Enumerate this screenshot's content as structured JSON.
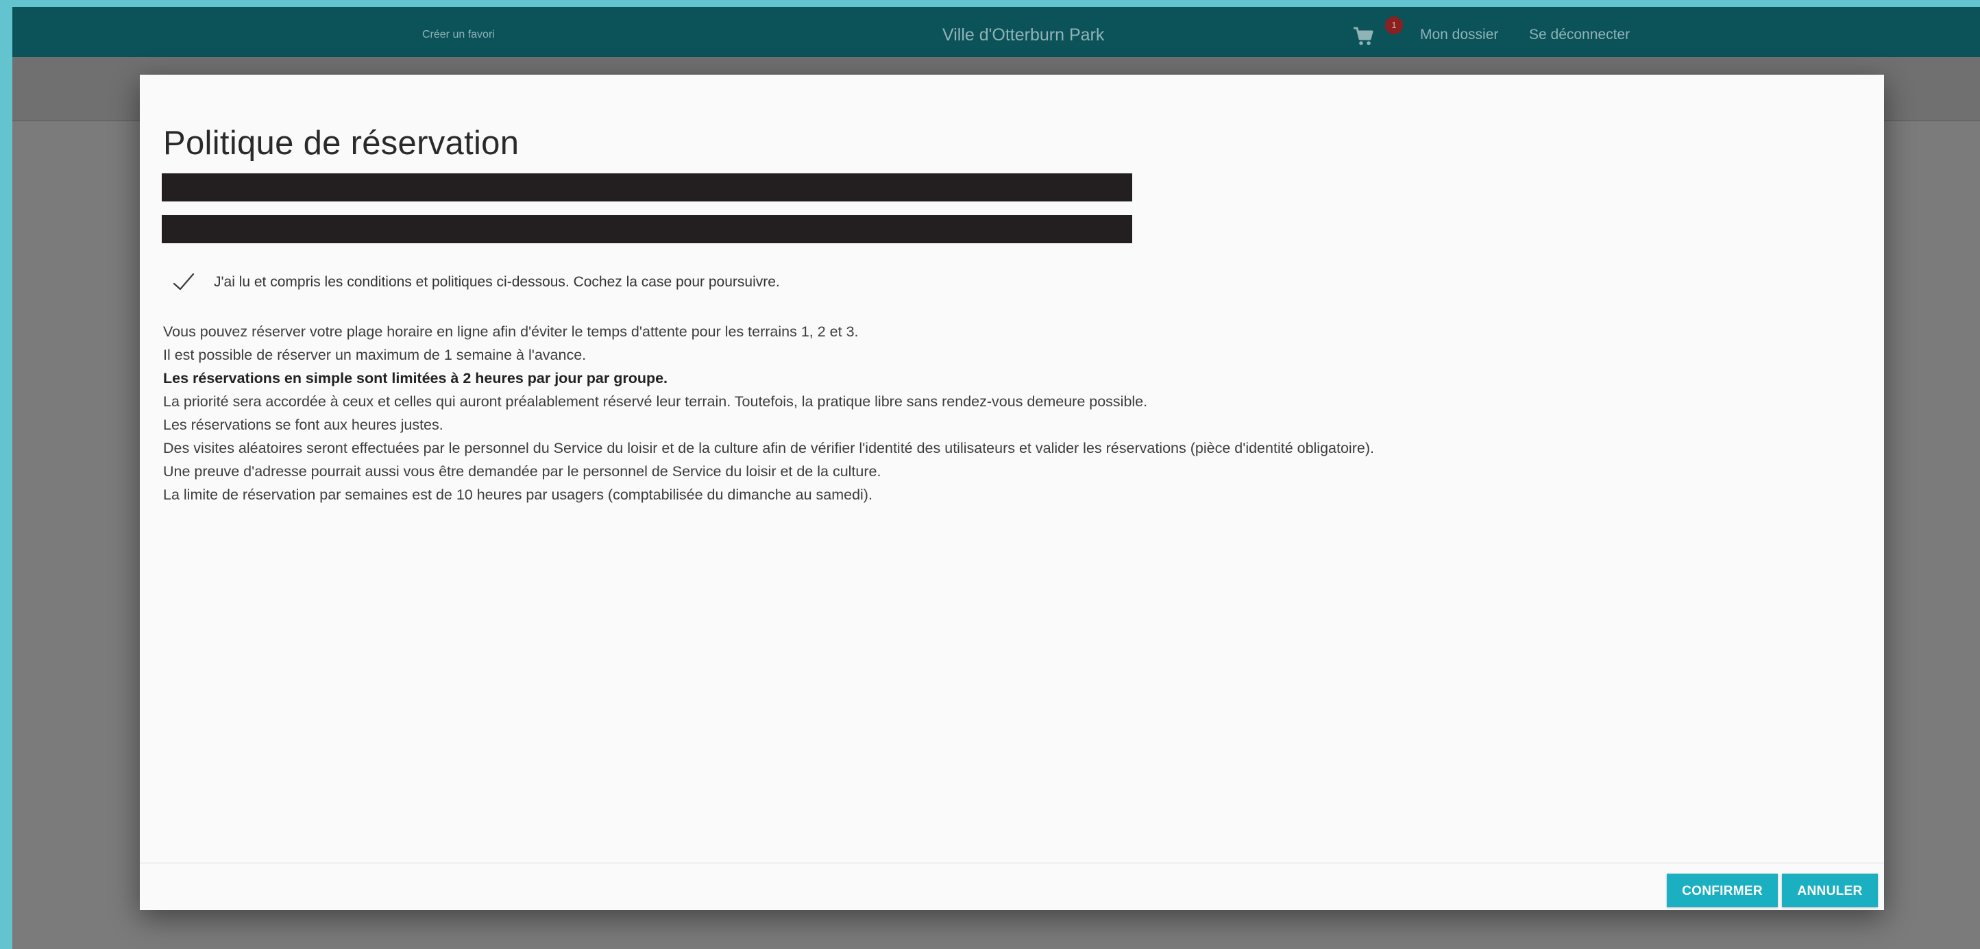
{
  "header": {
    "favorite_link": "Créer un favori",
    "site_title": "Ville d'Otterburn Park",
    "cart_icon": "cart-icon",
    "cart_count": "1",
    "my_account": "Mon dossier",
    "logout": "Se déconnecter"
  },
  "modal": {
    "title": "Politique de réservation",
    "acknowledge_text": "J'ai lu et compris les conditions et politiques ci-dessous. Cochez la case pour poursuivre.",
    "acknowledge_checked": true,
    "policy_lines": [
      "Vous pouvez réserver votre plage horaire en ligne afin d'éviter le temps d'attente pour les terrains 1, 2 et 3.",
      "Il est possible de réserver un maximum de 1 semaine à l'avance.",
      "Les réservations en simple sont limitées à 2 heures par jour par groupe.",
      "La priorité sera accordée à ceux et celles qui auront préalablement réservé leur terrain. Toutefois, la pratique libre sans rendez-vous demeure possible.",
      "Les réservations se font aux heures justes.",
      "Des visites aléatoires seront effectuées par le personnel du Service du loisir et de la culture afin de vérifier l'identité des utilisateurs et valider les réservations (pièce d'identité obligatoire).",
      "Une preuve d'adresse pourrait aussi vous être demandée par le personnel de Service du loisir et de la culture.",
      "La limite de réservation par semaines est de 10 heures par usagers (comptabilisée du dimanche au samedi)."
    ],
    "confirm_label": "CONFIRMER",
    "cancel_label": "ANNULER"
  },
  "colors": {
    "header_bg": "#0b5259",
    "accent_button": "#1bb0c1",
    "badge": "#8b2020",
    "outer_frame": "#63c4cf"
  }
}
